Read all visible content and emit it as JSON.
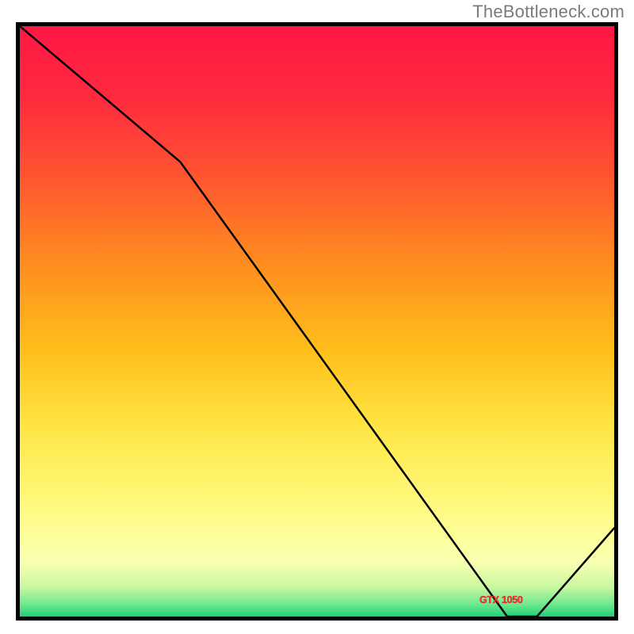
{
  "watermark": "TheBottleneck.com",
  "gradient": {
    "stops": [
      {
        "offset": "0%",
        "color": "#ff1744"
      },
      {
        "offset": "12%",
        "color": "#ff2a3e"
      },
      {
        "offset": "25%",
        "color": "#ff5330"
      },
      {
        "offset": "40%",
        "color": "#ff8c20"
      },
      {
        "offset": "55%",
        "color": "#ffbf1a"
      },
      {
        "offset": "68%",
        "color": "#ffe545"
      },
      {
        "offset": "78%",
        "color": "#fff570"
      },
      {
        "offset": "86%",
        "color": "#ffff99"
      },
      {
        "offset": "91%",
        "color": "#f7ffb0"
      },
      {
        "offset": "95%",
        "color": "#c9f7a0"
      },
      {
        "offset": "98%",
        "color": "#6ce88e"
      },
      {
        "offset": "100%",
        "color": "#1ecf77"
      }
    ]
  },
  "chart_data": {
    "type": "line",
    "title": "",
    "xlabel": "",
    "ylabel": "",
    "x": [
      0.0,
      0.27,
      0.82,
      0.84,
      0.87,
      1.0
    ],
    "values": [
      1.0,
      0.77,
      0.0,
      0.0,
      0.0,
      0.15
    ],
    "ylim": [
      0,
      1
    ],
    "xlim": [
      0,
      1
    ],
    "notes": "Single black curve over vertical red→yellow→green gradient. Values are normalized; no axis ticks or labels visible."
  },
  "marker": {
    "label": "GTX 1050"
  }
}
